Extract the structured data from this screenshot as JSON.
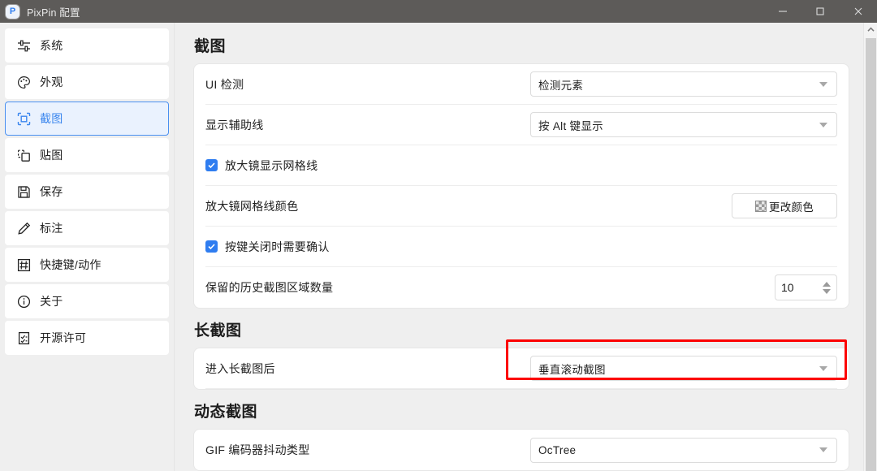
{
  "window": {
    "title": "PixPin 配置",
    "logo_letter": "P",
    "controls": {
      "minimize": "minimize-icon",
      "maximize": "maximize-icon",
      "close": "close-icon"
    }
  },
  "sidebar": {
    "items": [
      {
        "label": "系统",
        "icon": "sliders-icon",
        "active": false
      },
      {
        "label": "外观",
        "icon": "palette-icon",
        "active": false
      },
      {
        "label": "截图",
        "icon": "capture-icon",
        "active": true
      },
      {
        "label": "贴图",
        "icon": "pin-image-icon",
        "active": false
      },
      {
        "label": "保存",
        "icon": "save-icon",
        "active": false
      },
      {
        "label": "标注",
        "icon": "pencil-icon",
        "active": false
      },
      {
        "label": "快捷键/动作",
        "icon": "keyboard-icon",
        "active": false
      },
      {
        "label": "关于",
        "icon": "info-icon",
        "active": false
      },
      {
        "label": "开源许可",
        "icon": "license-icon",
        "active": false
      }
    ]
  },
  "main": {
    "sections": [
      {
        "title": "截图",
        "rows": [
          {
            "type": "select",
            "label": "UI 检测",
            "value": "检测元素"
          },
          {
            "type": "select",
            "label": "显示辅助线",
            "value": "按 Alt 键显示"
          },
          {
            "type": "checkbox",
            "label": "放大镜显示网格线",
            "checked": true
          },
          {
            "type": "button",
            "label": "放大镜网格线颜色",
            "value": "更改颜色",
            "icon": "color-swatch-icon"
          },
          {
            "type": "checkbox",
            "label": "按键关闭时需要确认",
            "checked": true
          },
          {
            "type": "spinner",
            "label": "保留的历史截图区域数量",
            "value": "10"
          }
        ]
      },
      {
        "title": "长截图",
        "rows": [
          {
            "type": "select",
            "label": "进入长截图后",
            "value": "垂直滚动截图",
            "highlighted": true
          }
        ]
      },
      {
        "title": "动态截图",
        "rows": [
          {
            "type": "select",
            "label": "GIF 编码器抖动类型",
            "value": "OcTree"
          }
        ]
      }
    ]
  },
  "colors": {
    "accent": "#2f7df0",
    "highlight_box": "#fc0000",
    "titlebar_bg": "#5d5b59",
    "page_bg": "#efefef"
  },
  "scrollbar": {
    "arrow": "chevron-up-icon"
  }
}
